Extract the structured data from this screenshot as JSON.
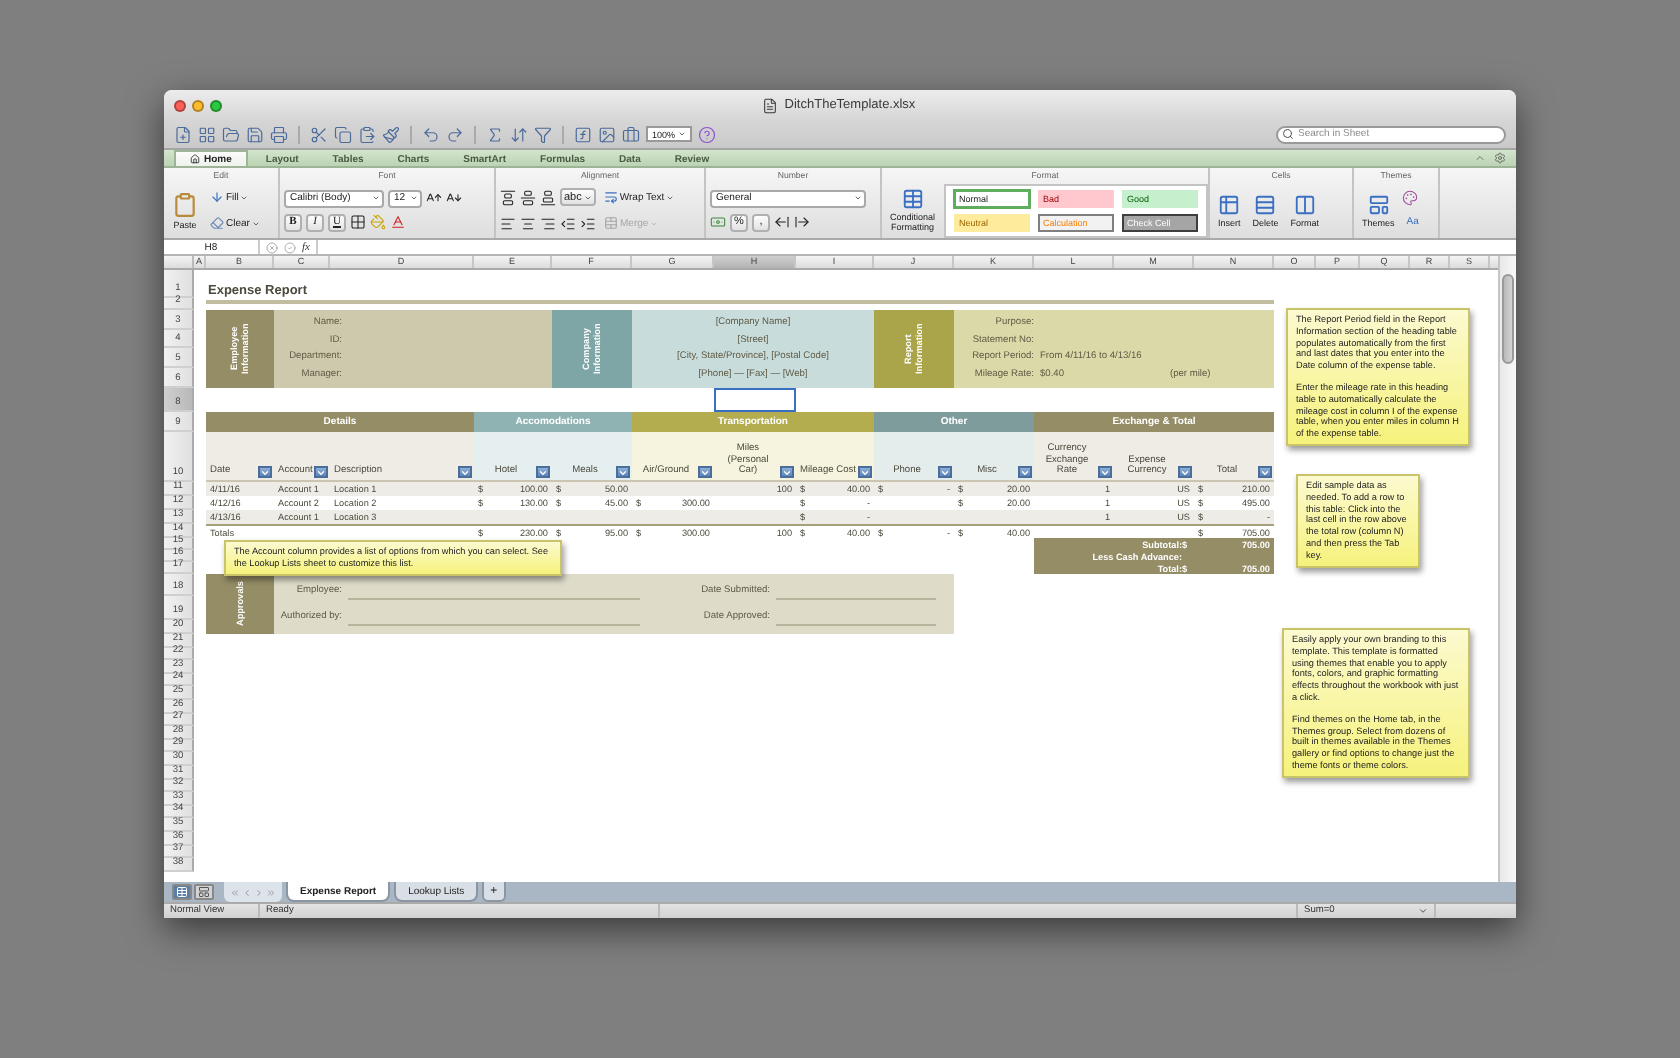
{
  "window": {
    "title": "DitchTheTemplate.xlsx"
  },
  "toolbar": {
    "zoom": "100%",
    "search": {
      "placeholder": "Search in Sheet"
    }
  },
  "ribbon_tabs": [
    {
      "label": "Home",
      "selected": true
    },
    {
      "label": "Layout",
      "selected": false
    },
    {
      "label": "Tables",
      "selected": false
    },
    {
      "label": "Charts",
      "selected": false
    },
    {
      "label": "SmartArt",
      "selected": false
    },
    {
      "label": "Formulas",
      "selected": false
    },
    {
      "label": "Data",
      "selected": false
    },
    {
      "label": "Review",
      "selected": false
    }
  ],
  "ribbon": {
    "edit": {
      "title": "Edit",
      "paste": "Paste",
      "fill": "Fill",
      "clear": "Clear"
    },
    "font": {
      "title": "Font",
      "family": "Calibri (Body)",
      "size": "12",
      "bold": "B",
      "italic": "I",
      "underline": "U"
    },
    "alignment": {
      "title": "Alignment",
      "orientation": "abc",
      "wrap": "Wrap Text",
      "merge": {
        "label": "Merge",
        "disabled": true
      }
    },
    "number": {
      "title": "Number",
      "format": "General",
      "percent": "%",
      "comma": ","
    },
    "format": {
      "title": "Format",
      "conditional": "Conditional Formatting",
      "styles": [
        {
          "label": "Normal",
          "kind": "normal",
          "selected": true
        },
        {
          "label": "Bad",
          "kind": "bad",
          "selected": false
        },
        {
          "label": "Good",
          "kind": "good",
          "selected": false
        },
        {
          "label": "Neutral",
          "kind": "neutral",
          "selected": false
        },
        {
          "label": "Calculation",
          "kind": "calculation",
          "selected": false
        },
        {
          "label": "Check Cell",
          "kind": "check",
          "selected": false
        }
      ]
    },
    "cells": {
      "title": "Cells",
      "buttons": [
        "Insert",
        "Delete",
        "Format"
      ]
    },
    "themes": {
      "title": "Themes",
      "button": "Themes",
      "fonts": "Aa"
    }
  },
  "formula_bar": {
    "cell": "H8",
    "fx": "fx"
  },
  "columns": [
    {
      "label": "A",
      "selected": false
    },
    {
      "label": "B",
      "selected": false
    },
    {
      "label": "C",
      "selected": false
    },
    {
      "label": "D",
      "selected": false
    },
    {
      "label": "E",
      "selected": false
    },
    {
      "label": "F",
      "selected": false
    },
    {
      "label": "G",
      "selected": false
    },
    {
      "label": "H",
      "selected": true
    },
    {
      "label": "I",
      "selected": false
    },
    {
      "label": "J",
      "selected": false
    },
    {
      "label": "K",
      "selected": false
    },
    {
      "label": "L",
      "selected": false
    },
    {
      "label": "M",
      "selected": false
    },
    {
      "label": "N",
      "selected": false
    },
    {
      "label": "O",
      "selected": false
    },
    {
      "label": "P",
      "selected": false
    },
    {
      "label": "Q",
      "selected": false
    },
    {
      "label": "R",
      "selected": false
    },
    {
      "label": "S",
      "selected": false
    }
  ],
  "row_numbers": [
    {
      "label": "1",
      "selected": false
    },
    {
      "label": "2",
      "selected": false
    },
    {
      "label": "3",
      "selected": false
    },
    {
      "label": "4",
      "selected": false
    },
    {
      "label": "5",
      "selected": false
    },
    {
      "label": "6",
      "selected": false
    },
    {
      "label": "8",
      "selected": true
    },
    {
      "label": "9",
      "selected": false
    },
    {
      "label": "10",
      "selected": false
    },
    {
      "label": "11",
      "selected": false
    },
    {
      "label": "12",
      "selected": false
    },
    {
      "label": "13",
      "selected": false
    },
    {
      "label": "14",
      "selected": false
    },
    {
      "label": "15",
      "selected": false
    },
    {
      "label": "16",
      "selected": false
    },
    {
      "label": "17",
      "selected": false
    },
    {
      "label": "18",
      "selected": false
    },
    {
      "label": "19",
      "selected": false
    },
    {
      "label": "20",
      "selected": false
    },
    {
      "label": "21",
      "selected": false
    },
    {
      "label": "22",
      "selected": false
    },
    {
      "label": "23",
      "selected": false
    },
    {
      "label": "24",
      "selected": false
    },
    {
      "label": "25",
      "selected": false
    },
    {
      "label": "26",
      "selected": false
    },
    {
      "label": "27",
      "selected": false
    },
    {
      "label": "28",
      "selected": false
    },
    {
      "label": "29",
      "selected": false
    },
    {
      "label": "30",
      "selected": false
    },
    {
      "label": "31",
      "selected": false
    },
    {
      "label": "32",
      "selected": false
    },
    {
      "label": "33",
      "selected": false
    },
    {
      "label": "34",
      "selected": false
    },
    {
      "label": "35",
      "selected": false
    },
    {
      "label": "36",
      "selected": false
    },
    {
      "label": "37",
      "selected": false
    },
    {
      "label": "38",
      "selected": false
    }
  ],
  "sheet_title": "Expense Report",
  "info_blocks": [
    {
      "kind": "fields",
      "label": "Employee Information",
      "fields": [
        {
          "label": "Name:"
        },
        {
          "label": "ID:"
        },
        {
          "label": "Department:"
        },
        {
          "label": "Manager:"
        }
      ]
    },
    {
      "kind": "lines",
      "label": "Company Information",
      "lines": [
        "[Company Name]",
        "[Street]",
        "[City, State/Province], [Postal Code]",
        "[Phone] — [Fax] — [Web]"
      ]
    },
    {
      "kind": "fields",
      "label": "Report Information",
      "fields": [
        {
          "label": "Purpose:"
        },
        {
          "label": "Statement No:"
        },
        {
          "label": "Report Period:",
          "value": "From 4/11/16 to 4/13/16"
        },
        {
          "label": "Mileage Rate:",
          "value": "$0.40",
          "unit": "(per mile)"
        }
      ]
    }
  ],
  "expense_table": {
    "sections": [
      {
        "title": "Details",
        "columns": [
          "Date",
          "Account",
          "Description"
        ]
      },
      {
        "title": "Accomodations",
        "columns": [
          "Hotel",
          "Meals"
        ]
      },
      {
        "title": "Transportation",
        "columns": [
          "Air/Ground",
          "Miles (Personal Car)",
          "Mileage Cost"
        ]
      },
      {
        "title": "Other",
        "columns": [
          "Phone",
          "Misc"
        ]
      },
      {
        "title": "Exchange & Total",
        "columns": [
          "Currency Exchange Rate",
          "Expense Currency",
          "Total"
        ]
      }
    ],
    "rows": [
      {
        "cells": [
          "4/11/16",
          "Account 1",
          "Location 1",
          {
            "sign": "$",
            "value": "100.00"
          },
          {
            "sign": "$",
            "value": "50.00"
          },
          null,
          "100",
          {
            "sign": "$",
            "value": "40.00"
          },
          {
            "sign": "$",
            "value": "-"
          },
          {
            "sign": "$",
            "value": "20.00"
          },
          "1",
          "US",
          {
            "sign": "$",
            "value": "210.00"
          }
        ]
      },
      {
        "cells": [
          "4/12/16",
          "Account 2",
          "Location 2",
          {
            "sign": "$",
            "value": "130.00"
          },
          {
            "sign": "$",
            "value": "45.00"
          },
          {
            "sign": "$",
            "value": "300.00"
          },
          null,
          {
            "sign": "$",
            "value": "-"
          },
          null,
          {
            "sign": "$",
            "value": "20.00"
          },
          "1",
          "US",
          {
            "sign": "$",
            "value": "495.00"
          }
        ]
      },
      {
        "cells": [
          "4/13/16",
          "Account 1",
          "Location 3",
          null,
          null,
          null,
          null,
          {
            "sign": "$",
            "value": "-"
          },
          null,
          null,
          "1",
          "US",
          {
            "sign": "$",
            "value": "-"
          }
        ]
      }
    ],
    "totals": {
      "cells": [
        "Totals",
        null,
        null,
        {
          "sign": "$",
          "value": "230.00"
        },
        {
          "sign": "$",
          "value": "95.00"
        },
        {
          "sign": "$",
          "value": "300.00"
        },
        "100",
        {
          "sign": "$",
          "value": "40.00"
        },
        {
          "sign": "$",
          "value": "-"
        },
        {
          "sign": "$",
          "value": "40.00"
        },
        null,
        null,
        {
          "sign": "$",
          "value": "705.00"
        }
      ]
    }
  },
  "summary": [
    {
      "label": "Subtotal:",
      "sign": "$",
      "value": "705.00"
    },
    {
      "label": "Less Cash Advance:"
    },
    {
      "label": "Total:",
      "sign": "$",
      "value": "705.00"
    }
  ],
  "approvals": {
    "label": "Approvals",
    "fields": [
      {
        "label": "Employee:"
      },
      {
        "label": "Date Submitted:"
      },
      {
        "label": "Authorized by:"
      },
      {
        "label": "Date Approved:"
      }
    ]
  },
  "notes": [
    {
      "paragraphs": [
        "The Report Period field in the Report Information section of the heading table populates automatically from the first and last dates that you enter into the Date column of the expense table.",
        "Enter the mileage rate in this heading table to automatically calculate the mileage cost in column I of the expense table, when you enter miles in column H of the expense table."
      ]
    },
    {
      "paragraphs": [
        "Edit sample data as needed. To add a row to this table: Click into the last cell in the row above the total row (column N) and then press the Tab key."
      ]
    },
    {
      "paragraphs": [
        "The Account column provides a list of options from which you can select. See the Lookup Lists sheet to customize this list."
      ]
    },
    {
      "paragraphs": [
        "Easily apply your own branding to this template. This template is formatted using themes that enable you to apply fonts, colors, and graphic formatting effects throughout the workbook with just a click.",
        "Find themes on the Home tab, in the Themes group. Select from dozens of built in themes available in the Themes gallery or find options to change just the theme fonts or theme colors."
      ]
    }
  ],
  "sheet_tabs": [
    {
      "label": "Expense Report",
      "selected": true
    },
    {
      "label": "Lookup Lists",
      "selected": false
    }
  ],
  "add_sheet": "+",
  "status_bar": {
    "view": "Normal View",
    "state": "Ready",
    "sum": "Sum=0"
  }
}
